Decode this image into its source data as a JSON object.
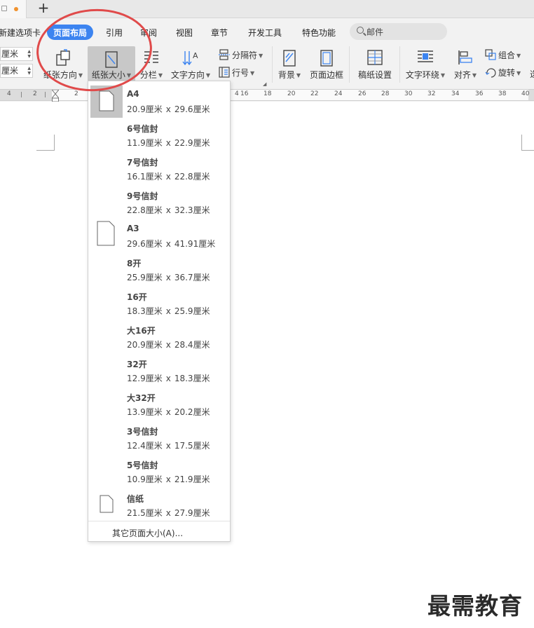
{
  "tabs": {
    "new_tab_icon": "plus-icon"
  },
  "menubar": {
    "items": [
      "新建选项卡",
      "页面布局",
      "引用",
      "审阅",
      "视图",
      "章节",
      "开发工具",
      "特色功能"
    ],
    "active": "页面布局",
    "search_placeholder": "邮件"
  },
  "ribbon": {
    "spin_top_value": "厘米",
    "spin_bottom_value": "厘米",
    "orientation_label": "纸张方向",
    "paper_size_label": "纸张大小",
    "columns_label": "分栏",
    "text_direction_label": "文字方向",
    "separator_label": "分隔符",
    "line_number_label": "行号",
    "background_label": "背景",
    "page_border_label": "页面边框",
    "manuscript_label": "稿纸设置",
    "text_wrap_label": "文字环绕",
    "align_label": "对齐",
    "group_label": "组合",
    "rotate_label": "旋转"
  },
  "ruler": {
    "ticks": [
      "4",
      "2",
      "2",
      "4",
      "16",
      "18",
      "20",
      "22",
      "24",
      "26",
      "28",
      "30",
      "32",
      "34",
      "36",
      "38",
      "40"
    ]
  },
  "paper_sizes": [
    {
      "name": "A4",
      "w": "20.9厘米",
      "h": "29.6厘米",
      "selected": true
    },
    {
      "name": "6号信封",
      "w": "11.9厘米",
      "h": "22.9厘米"
    },
    {
      "name": "7号信封",
      "w": "16.1厘米",
      "h": "22.8厘米"
    },
    {
      "name": "9号信封",
      "w": "22.8厘米",
      "h": "32.3厘米"
    },
    {
      "name": "A3",
      "w": "29.6厘米",
      "h": "41.91厘米",
      "icon": "page-icon"
    },
    {
      "name": "8开",
      "w": "25.9厘米",
      "h": "36.7厘米"
    },
    {
      "name": "16开",
      "w": "18.3厘米",
      "h": "25.9厘米"
    },
    {
      "name": "大16开",
      "w": "20.9厘米",
      "h": "28.4厘米"
    },
    {
      "name": "32开",
      "w": "12.9厘米",
      "h": "18.3厘米"
    },
    {
      "name": "大32开",
      "w": "13.9厘米",
      "h": "20.2厘米"
    },
    {
      "name": "3号信封",
      "w": "12.4厘米",
      "h": "17.5厘米"
    },
    {
      "name": "5号信封",
      "w": "10.9厘米",
      "h": "21.9厘米"
    },
    {
      "name": "信纸",
      "w": "21.5厘米",
      "h": "27.9厘米",
      "icon": "page-icon"
    }
  ],
  "times_sign": "x",
  "more_sizes": "其它页面大小(A)...",
  "annotation_color": "#e04a4a",
  "accent_color": "#3c84f0",
  "watermark": "最需教育"
}
